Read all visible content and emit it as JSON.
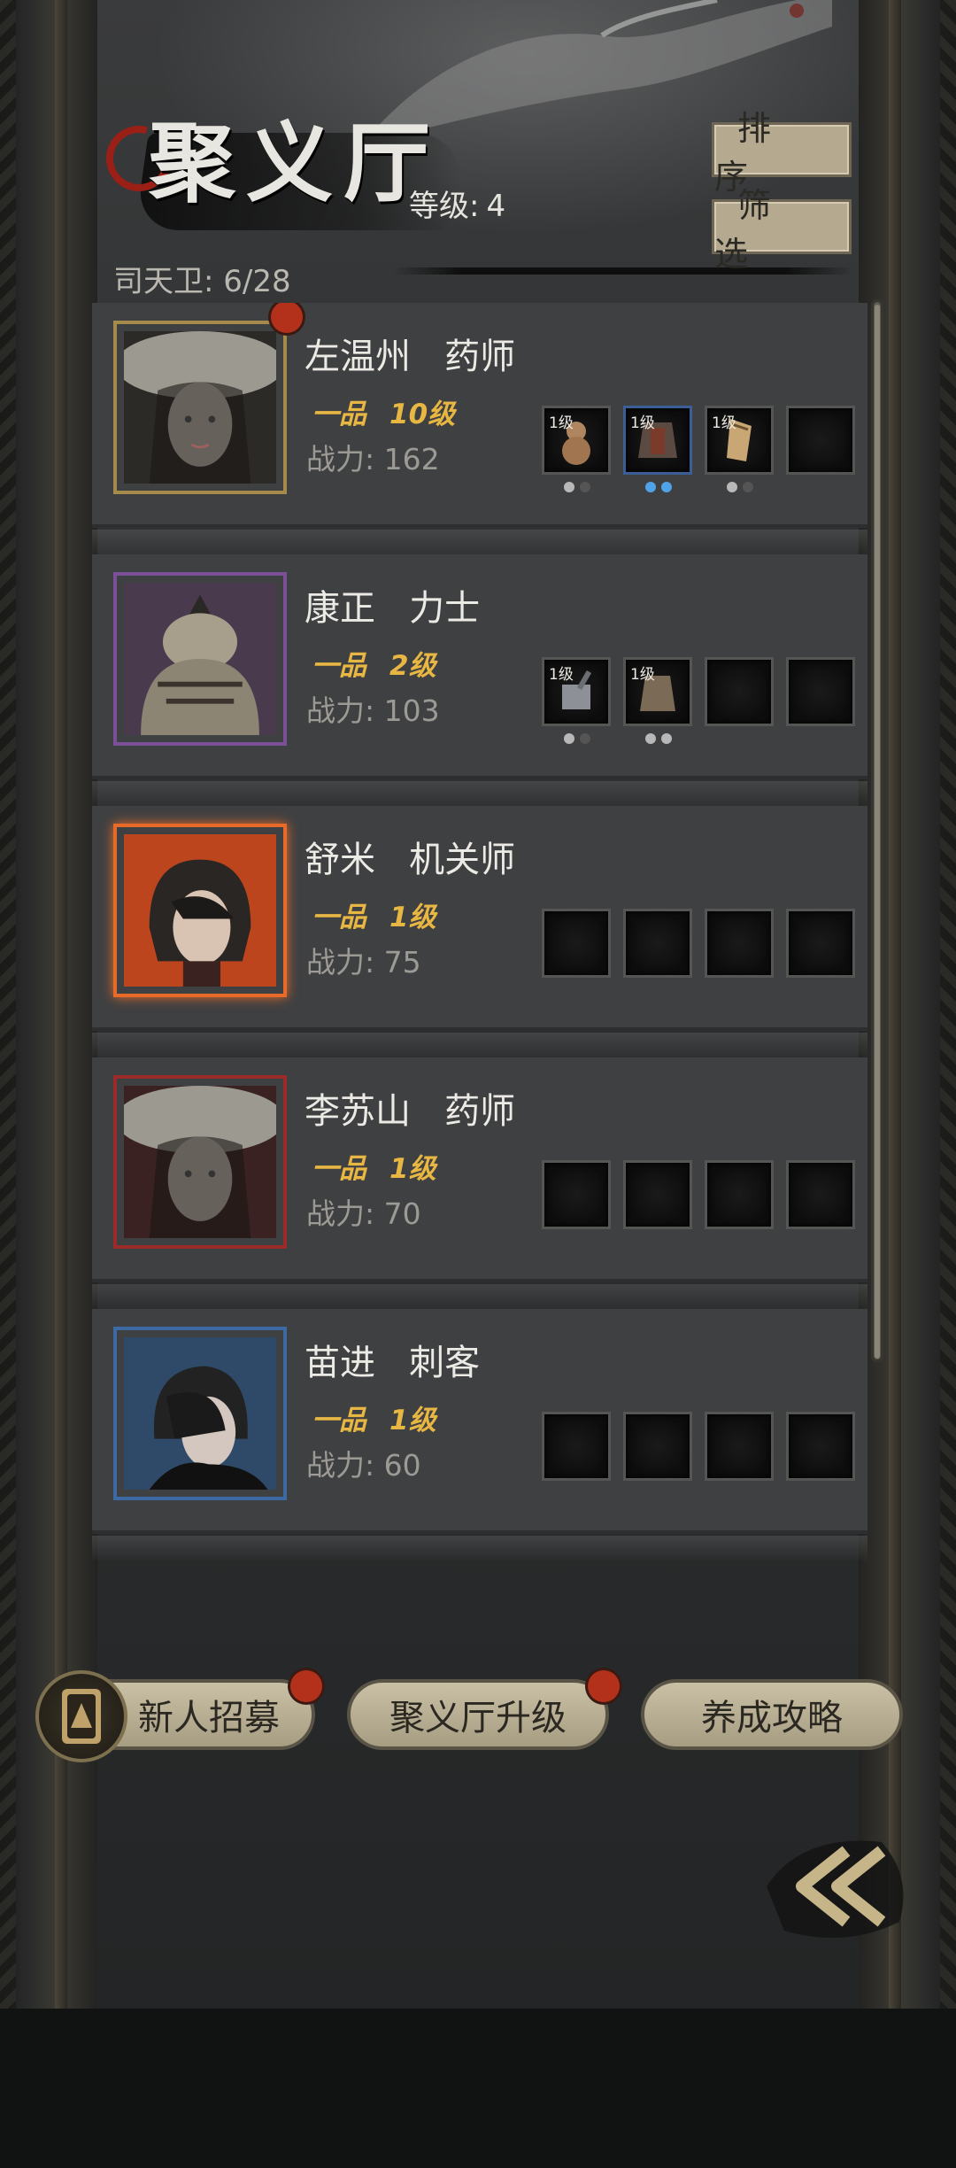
{
  "header": {
    "title": "聚义厅",
    "level_label": "等级:",
    "level_value": "4",
    "hunter_count": "司天卫: 6/28"
  },
  "actions": {
    "sort_label": "排序",
    "filter_label": "筛选"
  },
  "heroes": [
    {
      "name": "左温州   药师",
      "grade": "一品",
      "level": "10级",
      "power": "战力: 162",
      "frame_color": "#a58a4c",
      "new_badge": true,
      "gear": [
        {
          "label": "1级",
          "icon": "gourd-icon"
        },
        {
          "label": "1级",
          "icon": "armor-icon"
        },
        {
          "label": "1级",
          "icon": "boot-icon"
        },
        {
          "label": "",
          "icon": "empty-slot"
        }
      ]
    },
    {
      "name": "康正   力士",
      "grade": "一品",
      "level": "2级",
      "power": "战力: 103",
      "frame_color": "#7c4f9b",
      "new_badge": false,
      "gear": [
        {
          "label": "1级",
          "icon": "hammer-icon"
        },
        {
          "label": "1级",
          "icon": "cloak-icon"
        },
        {
          "label": "",
          "icon": "empty-slot"
        },
        {
          "label": "",
          "icon": "empty-slot"
        }
      ]
    },
    {
      "name": "舒米   机关师",
      "grade": "一品",
      "level": "1级",
      "power": "战力: 75",
      "frame_color": "#e86a28",
      "new_badge": false,
      "gear": [
        {
          "label": "",
          "icon": "empty-slot"
        },
        {
          "label": "",
          "icon": "empty-slot"
        },
        {
          "label": "",
          "icon": "empty-slot"
        },
        {
          "label": "",
          "icon": "empty-slot"
        }
      ]
    },
    {
      "name": "李苏山   药师",
      "grade": "一品",
      "level": "1级",
      "power": "战力: 70",
      "frame_color": "#9b2a2a",
      "new_badge": false,
      "gear": [
        {
          "label": "",
          "icon": "empty-slot"
        },
        {
          "label": "",
          "icon": "empty-slot"
        },
        {
          "label": "",
          "icon": "empty-slot"
        },
        {
          "label": "",
          "icon": "empty-slot"
        }
      ]
    },
    {
      "name": "苗进   刺客",
      "grade": "一品",
      "level": "1级",
      "power": "战力: 60",
      "frame_color": "#3d6aa3",
      "new_badge": false,
      "gear": [
        {
          "label": "",
          "icon": "empty-slot"
        },
        {
          "label": "",
          "icon": "empty-slot"
        },
        {
          "label": "",
          "icon": "empty-slot"
        },
        {
          "label": "",
          "icon": "empty-slot"
        }
      ]
    }
  ],
  "bottom": {
    "recruit_label": "新人招募",
    "upgrade_label": "聚义厅升级",
    "guide_label": "养成攻略"
  },
  "colors": {
    "accent_gold": "#e8b642",
    "badge_red": "#b3311b",
    "button_tan": "#b5aa90"
  }
}
